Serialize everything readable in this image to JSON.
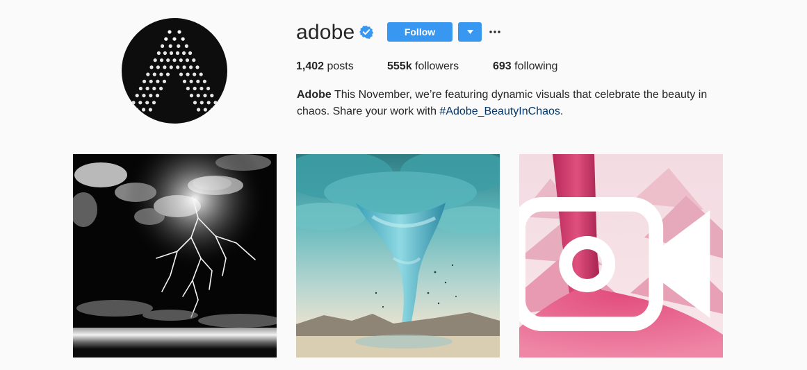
{
  "profile": {
    "username": "adobe",
    "verified_icon": "verified-badge-icon",
    "follow_label": "Follow",
    "dropdown_icon": "caret-down-icon",
    "more_icon": "more-options-icon"
  },
  "stats": {
    "posts_count": "1,402",
    "posts_label": "posts",
    "followers_count": "555k",
    "followers_label": "followers",
    "following_count": "693",
    "following_label": "following"
  },
  "bio": {
    "name": "Adobe",
    "text_before": "This November, we’re featuring dynamic visuals that celebrate the beauty in chaos. Share your work with ",
    "hashtag": "#Adobe_BeautyInChaos",
    "text_after": "."
  },
  "posts": [
    {
      "kind": "image",
      "subject": "lightning-storm"
    },
    {
      "kind": "image",
      "subject": "tornado"
    },
    {
      "kind": "video",
      "subject": "pink-sand",
      "badge_icon": "video-camera-icon"
    }
  ],
  "colors": {
    "accent": "#3897f0",
    "link": "#003569",
    "text": "#262626",
    "background": "#fafafa"
  }
}
